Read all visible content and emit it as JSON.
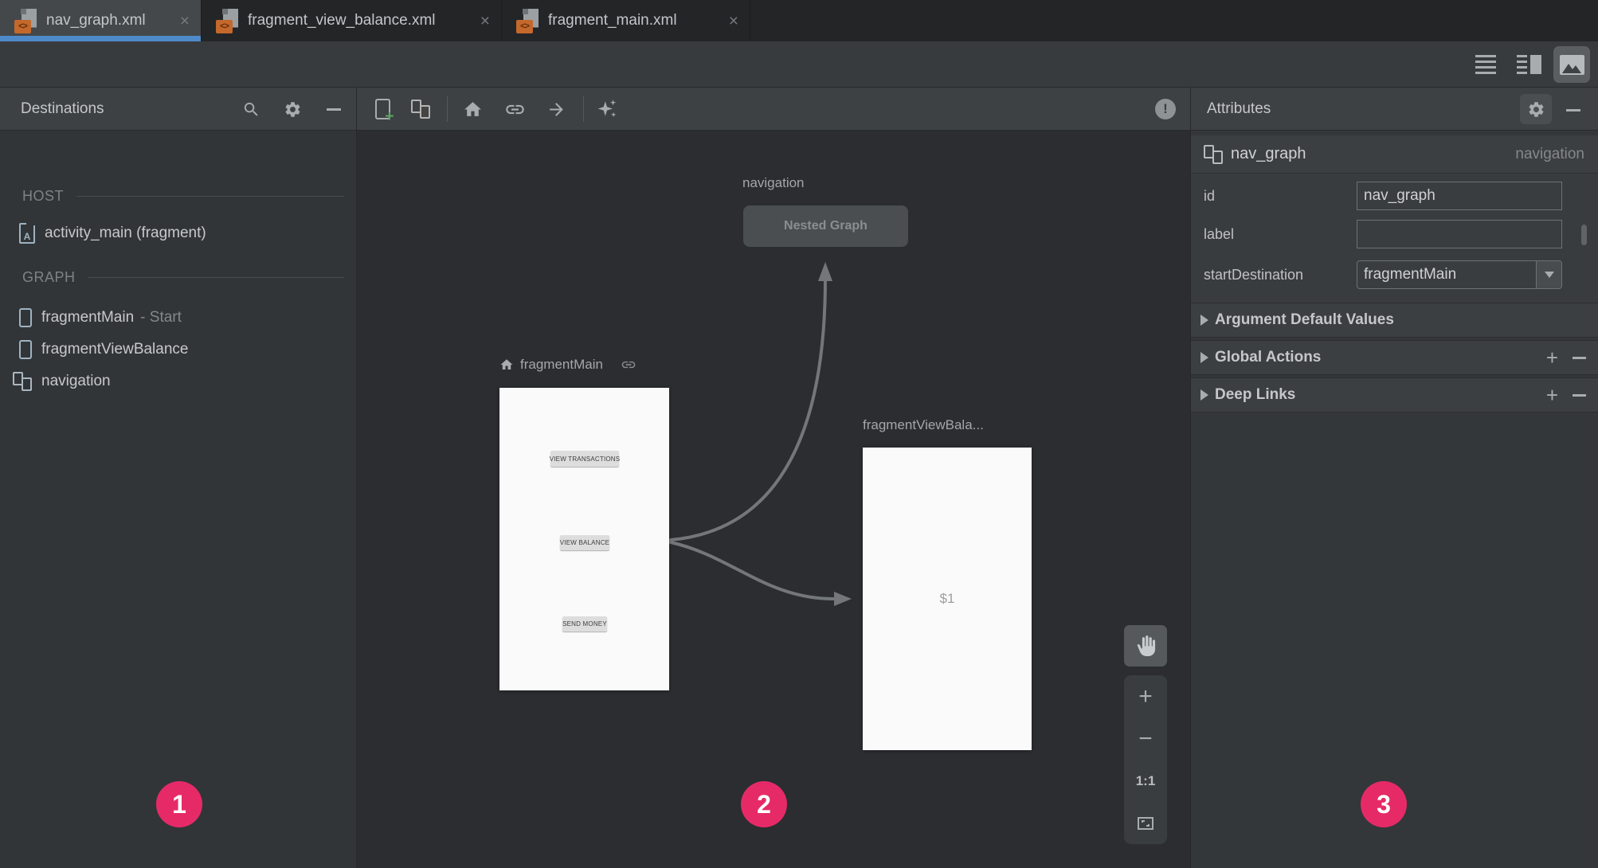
{
  "tabs": [
    {
      "label": "nav_graph.xml",
      "active": true
    },
    {
      "label": "fragment_view_balance.xml",
      "active": false
    },
    {
      "label": "fragment_main.xml",
      "active": false
    }
  ],
  "destinations": {
    "title": "Destinations",
    "host_section": "HOST",
    "graph_section": "GRAPH",
    "host_item": {
      "label": "activity_main (fragment)"
    },
    "graph_items": [
      {
        "label": "fragmentMain",
        "suffix": "- Start"
      },
      {
        "label": "fragmentViewBalance",
        "suffix": ""
      },
      {
        "label": "navigation",
        "suffix": ""
      }
    ]
  },
  "canvas": {
    "nested_graph_label": "navigation",
    "nested_graph_text": "Nested Graph",
    "fragment_main_label": "fragmentMain",
    "fragment_main_buttons": [
      "VIEW TRANSACTIONS",
      "VIEW BALANCE",
      "SEND MONEY"
    ],
    "fragment_view_balance_label": "fragmentViewBala...",
    "fragment_view_balance_text": "$1",
    "zoom_level_label": "1:1"
  },
  "attributes": {
    "title": "Attributes",
    "component_name": "nav_graph",
    "component_type": "navigation",
    "fields": [
      {
        "label": "id",
        "value": "nav_graph"
      },
      {
        "label": "label",
        "value": ""
      },
      {
        "label": "startDestination",
        "value": "fragmentMain"
      }
    ],
    "sections": [
      {
        "label": "Argument Default Values"
      },
      {
        "label": "Global Actions"
      },
      {
        "label": "Deep Links"
      }
    ]
  },
  "annotations": {
    "badges": [
      "1",
      "2",
      "3"
    ]
  },
  "colors": {
    "badge_pink": "#E62A68",
    "tab_underline_blue": "#4E8AC9",
    "canvas_bg": "#2B2D30",
    "panel_bg": "#3D4143",
    "phone_bg": "#FAFAFA",
    "new_destination_green": "#5CA666"
  },
  "icons": {
    "tab_file": "xml-file-icon",
    "view_modes": [
      "code-view-icon",
      "split-view-icon",
      "design-view-icon"
    ],
    "destinations_header": [
      "search-icon",
      "gear-icon",
      "hide-icon"
    ],
    "canvas_toolbar": [
      "new-destination-icon",
      "nested-graph-icon",
      "home-icon",
      "deep-link-icon",
      "action-arrow-icon",
      "sparkles-icon",
      "error-icon"
    ],
    "zoom_controls": [
      "pan-hand-icon",
      "zoom-in-icon",
      "zoom-out-icon",
      "zoom-fit-icon"
    ]
  }
}
